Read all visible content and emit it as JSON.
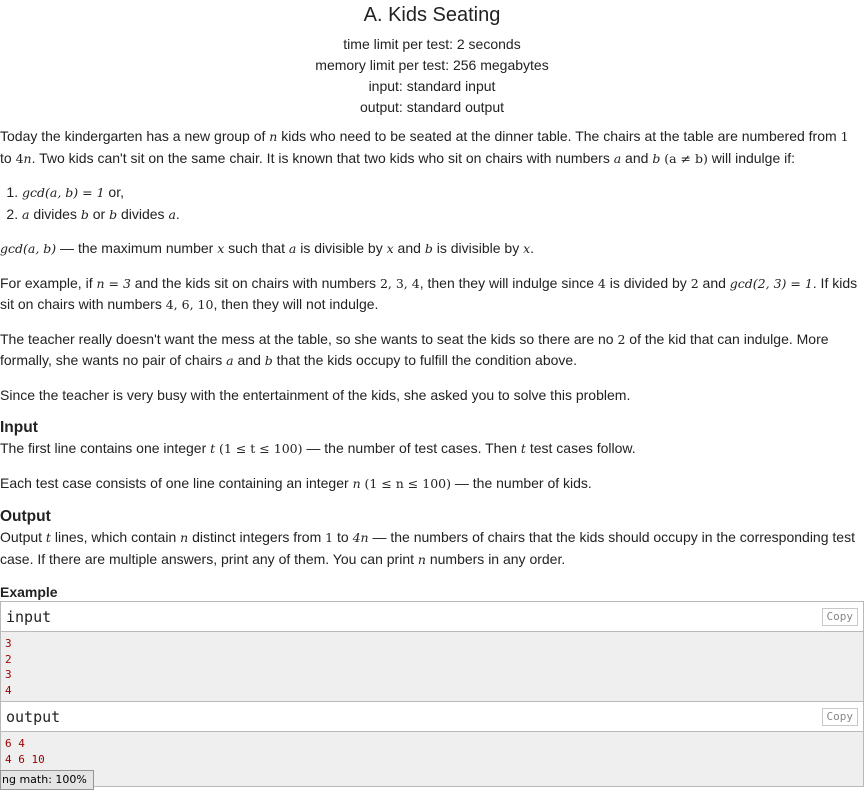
{
  "problem": {
    "title": "A. Kids Seating",
    "time_limit": "time limit per test: 2 seconds",
    "memory_limit": "memory limit per test: 256 megabytes",
    "input_file": "input: standard input",
    "output_file": "output: standard output"
  },
  "statement": {
    "p1_a": "Today the kindergarten has a new group of ",
    "p1_n": "n",
    "p1_b": " kids who need to be seated at the dinner table. The chairs at the table are numbered from ",
    "p1_one": "1",
    "p1_c": " to ",
    "p1_4n": "4",
    "p1_4n_n": "n",
    "p1_d": ". Two kids can't sit on the same chair. It is known that two kids who sit on chairs with numbers ",
    "p1_a_var": "a",
    "p1_e": " and ",
    "p1_b_var": "b",
    "p1_neq": "(a ≠ b)",
    "p1_f": " will indulge if:",
    "cond1_math": "gcd(a, b) = 1",
    "cond1_text": " or,",
    "cond2_a": "a",
    "cond2_t1": " divides ",
    "cond2_b": "b",
    "cond2_t2": " or ",
    "cond2_b2": "b",
    "cond2_t3": " divides ",
    "cond2_a2": "a",
    "cond2_end": ".",
    "gcd_def_math": "gcd(a, b)",
    "gcd_def_t1": " — the maximum number ",
    "gcd_def_x": "x",
    "gcd_def_t2": " such that ",
    "gcd_def_a": "a",
    "gcd_def_t3": " is divisible by ",
    "gcd_def_x2": "x",
    "gcd_def_t4": " and ",
    "gcd_def_b": "b",
    "gcd_def_t5": " is divisible by ",
    "gcd_def_x3": "x",
    "gcd_def_end": ".",
    "ex_t1": "For example, if ",
    "ex_n3": "n = 3",
    "ex_t2": " and the kids sit on chairs with numbers ",
    "ex_nums1": "2, 3, 4",
    "ex_t3": ", then they will indulge since ",
    "ex_4": "4",
    "ex_t4": " is divided by ",
    "ex_2": "2",
    "ex_t5": " and ",
    "ex_gcd": "gcd(2, 3) = 1",
    "ex_t6": ". If kids sit on chairs with numbers ",
    "ex_nums2": "4, 6, 10",
    "ex_t7": ", then they will not indulge.",
    "teacher_t1": "The teacher really doesn't want the mess at the table, so she wants to seat the kids so there are no ",
    "teacher_2": "2",
    "teacher_t2": " of the kid that can indulge. More formally, she wants no pair of chairs ",
    "teacher_a": "a",
    "teacher_t3": " and ",
    "teacher_b": "b",
    "teacher_t4": " that the kids occupy to fulfill the condition above.",
    "busy": "Since the teacher is very busy with the entertainment of the kids, she asked you to solve this problem."
  },
  "input_section": {
    "title": "Input",
    "t1": "The first line contains one integer ",
    "t_var": "t",
    "t_range": "(1 ≤ t ≤ 100)",
    "t2": " — the number of test cases. Then ",
    "t_var2": "t",
    "t3": " test cases follow.",
    "c1": "Each test case consists of one line containing an integer ",
    "n_var": "n",
    "n_range": "(1 ≤ n ≤ 100)",
    "c2": " — the number of kids."
  },
  "output_section": {
    "title": "Output",
    "t1": "Output ",
    "t_var": "t",
    "t2": " lines, which contain ",
    "n_var": "n",
    "t3": " distinct integers from ",
    "one": "1",
    "t4": " to ",
    "four_n": "4n",
    "t5": " — the numbers of chairs that the kids should occupy in the corresponding test case. If there are multiple answers, print any of them. You can print ",
    "n_var2": "n",
    "t6": " numbers in any order."
  },
  "example": {
    "title": "Example",
    "input_label": "input",
    "output_label": "output",
    "copy_label": "Copy",
    "input_lines": [
      "3",
      "2",
      "3",
      "4"
    ],
    "output_lines": [
      "6 4",
      "4 6 10"
    ]
  },
  "status": {
    "text": "ng math: 100%"
  }
}
